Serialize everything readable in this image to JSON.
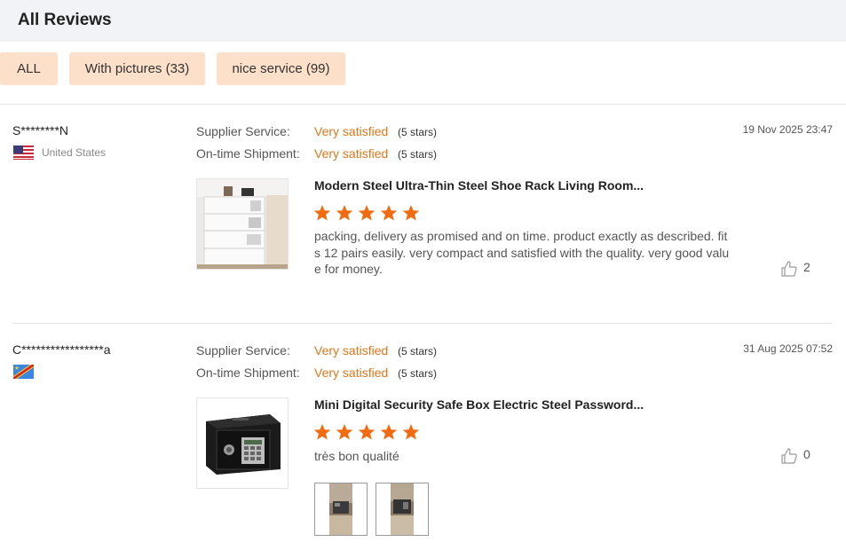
{
  "header": {
    "title": "All Reviews"
  },
  "filters": [
    {
      "label": "ALL"
    },
    {
      "label": "With pictures (33)"
    },
    {
      "label": "nice service (99)"
    }
  ],
  "reviews": [
    {
      "user": "S********N",
      "country": "United States",
      "supplier_label": "Supplier Service:",
      "supplier_value": "Very satisfied",
      "supplier_stars": "(5 stars)",
      "shipment_label": "On-time Shipment:",
      "shipment_value": "Very satisfied",
      "shipment_stars": "(5 stars)",
      "date": "19 Nov 2025 23:47",
      "product_title": "Modern Steel Ultra-Thin Steel Shoe Rack Living Room...",
      "rating": 5,
      "text": "packing, delivery as promised and on time. product exactly as described. fits 12 pairs easily. very compact and satisfied with the quality. very good value for money.",
      "helpful_count": "2"
    },
    {
      "user": "C*****************a",
      "country": "",
      "supplier_label": "Supplier Service:",
      "supplier_value": "Very satisfied",
      "supplier_stars": "(5 stars)",
      "shipment_label": "On-time Shipment:",
      "shipment_value": "Very satisfied",
      "shipment_stars": "(5 stars)",
      "date": "31 Aug 2025 07:52",
      "product_title": "Mini Digital Security Safe Box Electric Steel Password...",
      "rating": 5,
      "text": "très bon qualité",
      "helpful_count": "0"
    }
  ],
  "colors": {
    "accent": "#e0761a",
    "star": "#f26b10",
    "chip_bg": "#fde0c9",
    "header_bg": "#f1f3f6"
  }
}
